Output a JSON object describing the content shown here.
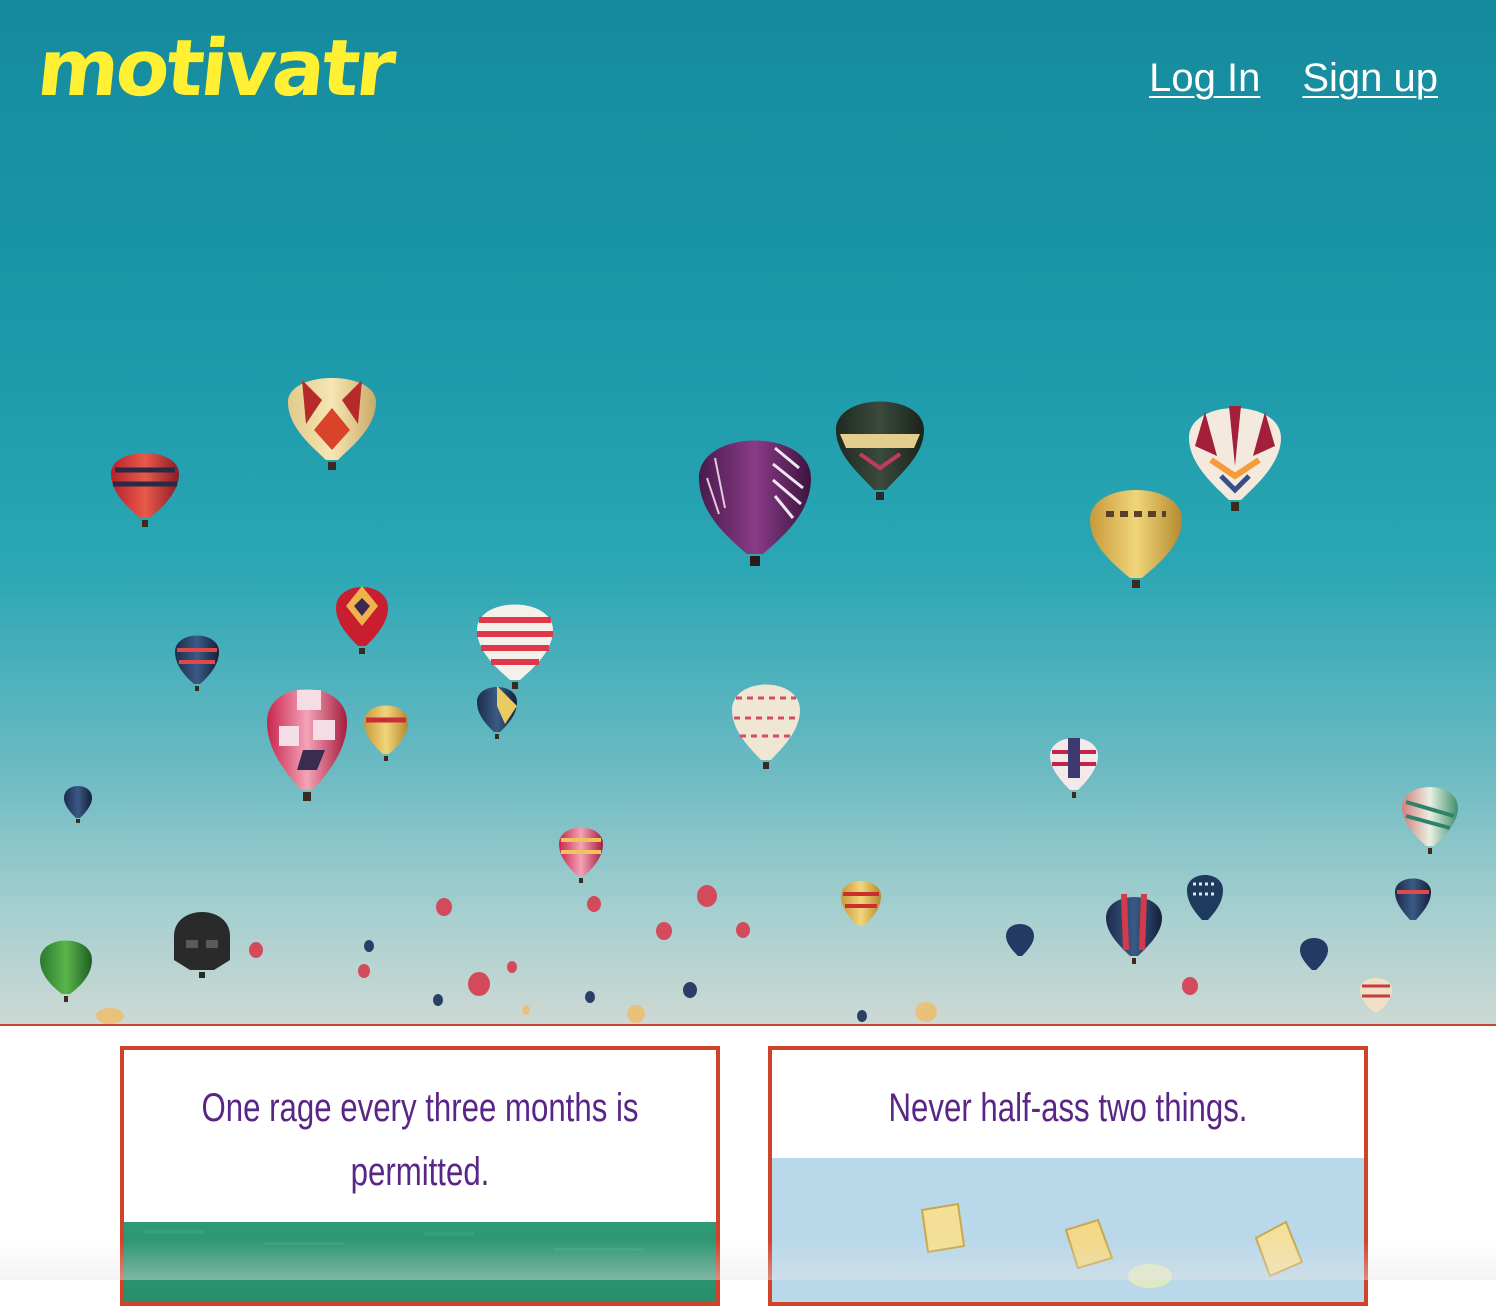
{
  "brand": {
    "logo_text": "motivatr",
    "logo_color": "#fff033"
  },
  "nav": {
    "login_label": "Log In",
    "signup_label": "Sign up"
  },
  "hero": {
    "image": "hot-air-balloons-sky"
  },
  "cards": [
    {
      "quote": "One rage every three months is permitted.",
      "image": "green-field"
    },
    {
      "quote": "Never half-ass two things.",
      "image": "pineapple-pieces-blue"
    }
  ],
  "colors": {
    "card_border": "#d0432b",
    "quote_text": "#5a2686"
  }
}
